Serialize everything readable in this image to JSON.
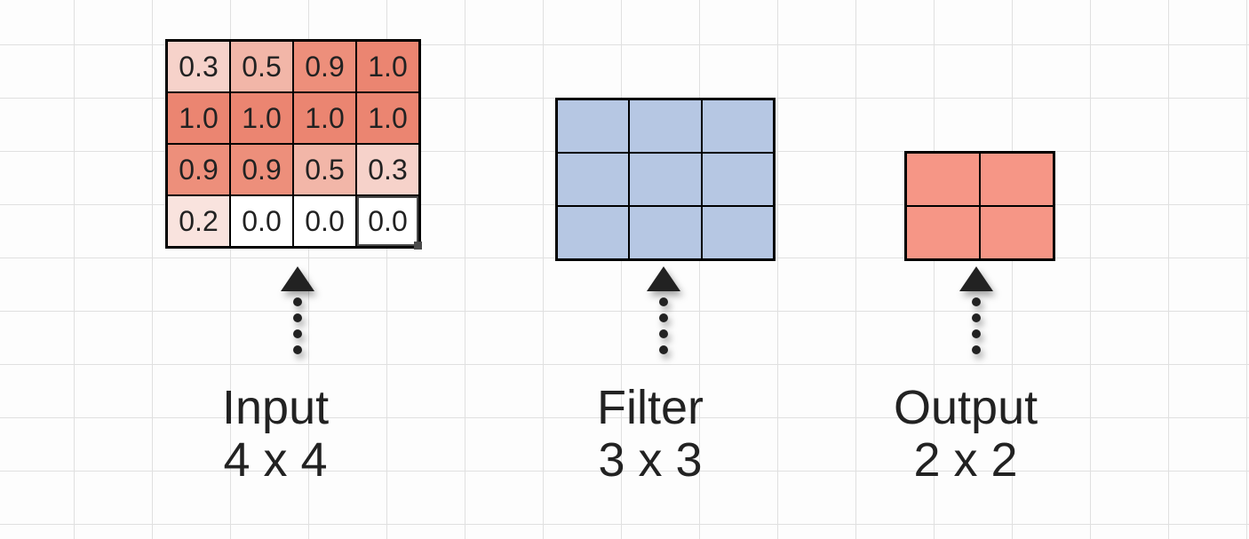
{
  "input": {
    "label_title": "Input",
    "label_dims": "4 x 4",
    "rows": 4,
    "cols": 4,
    "cells": [
      {
        "v": "0.3",
        "bg": "#f6d2ca"
      },
      {
        "v": "0.5",
        "bg": "#f2b6a8"
      },
      {
        "v": "0.9",
        "bg": "#ed8f7b"
      },
      {
        "v": "1.0",
        "bg": "#eb8571"
      },
      {
        "v": "1.0",
        "bg": "#eb8571"
      },
      {
        "v": "1.0",
        "bg": "#eb8571"
      },
      {
        "v": "1.0",
        "bg": "#eb8571"
      },
      {
        "v": "1.0",
        "bg": "#eb8571"
      },
      {
        "v": "0.9",
        "bg": "#ed8f7b"
      },
      {
        "v": "0.9",
        "bg": "#ed8f7b"
      },
      {
        "v": "0.5",
        "bg": "#f2b6a8"
      },
      {
        "v": "0.3",
        "bg": "#f6d2ca"
      },
      {
        "v": "0.2",
        "bg": "#f9e3de"
      },
      {
        "v": "0.0",
        "bg": "#ffffff"
      },
      {
        "v": "0.0",
        "bg": "#ffffff"
      },
      {
        "v": "0.0",
        "bg": "#ffffff"
      }
    ],
    "selected_index": 15
  },
  "filter": {
    "label_title": "Filter",
    "label_dims": "3 x 3",
    "rows": 3,
    "cols": 3,
    "cell_color": "#b6c7e3"
  },
  "output": {
    "label_title": "Output",
    "label_dims": "2 x 2",
    "rows": 2,
    "cols": 2,
    "cell_color": "#f69686"
  },
  "chart_data": {
    "type": "table",
    "description": "Convolution diagram: 4x4 input, 3x3 filter, 2x2 output",
    "input_matrix": [
      [
        0.3,
        0.5,
        0.9,
        1.0
      ],
      [
        1.0,
        1.0,
        1.0,
        1.0
      ],
      [
        0.9,
        0.9,
        0.5,
        0.3
      ],
      [
        0.2,
        0.0,
        0.0,
        0.0
      ]
    ],
    "filter_size": [
      3,
      3
    ],
    "output_size": [
      2,
      2
    ]
  }
}
